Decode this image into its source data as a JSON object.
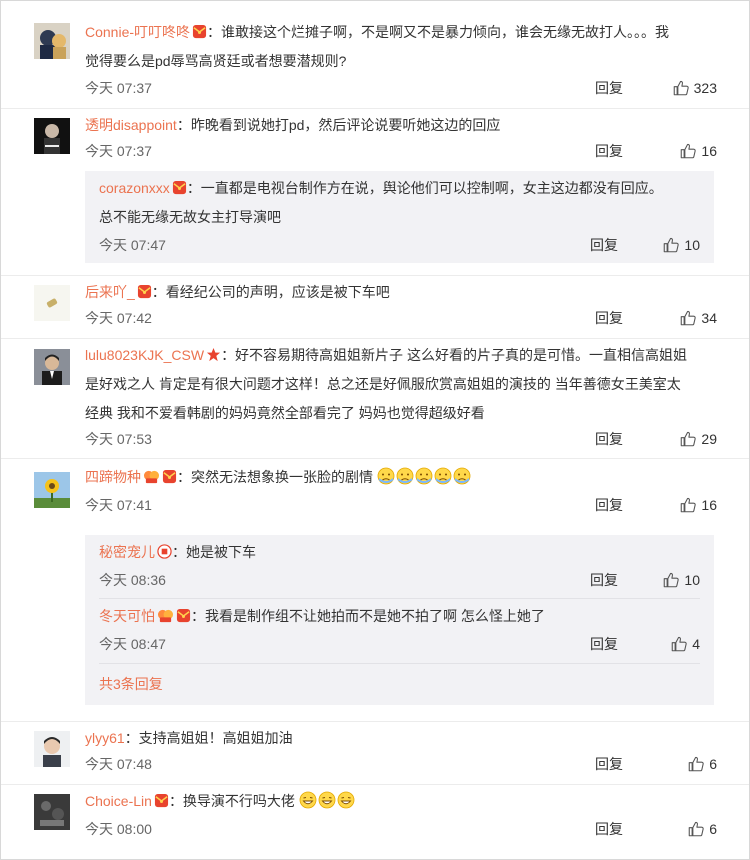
{
  "colors": {
    "name": "#eb7350",
    "text": "#333333",
    "meta": "#666666",
    "subbox_bg": "#f2f2f5"
  },
  "icons": {
    "badge": "red-envelope-badge-icon",
    "star": "red-star-badge-icon",
    "like": "thumb-up-icon",
    "fortune": "fortune-badge-icon",
    "fan": "fan-badge-icon",
    "emoji_sad": "sad-face-emoji",
    "emoji_grin": "grinning-face-emoji"
  },
  "comments": [
    {
      "name": "Connie-叮叮咚咚",
      "text1": "：谁敢接这个烂摊子啊，不是啊又不是暴力倾向，谁会无缘无故打人。。。我",
      "text2": "觉得要么是pd辱骂高贤廷或者想要潜规则?",
      "time": "今天 07:37",
      "reply": "回复",
      "likes": "323"
    },
    {
      "name": "透明disappoint",
      "text1": "：昨晚看到说她打pd，然后评论说要听她这边的回应",
      "time": "今天 07:37",
      "reply": "回复",
      "likes": "16",
      "subs": [
        {
          "name": "corazonxxx",
          "text1": "：一直都是电视台制作方在说，舆论他们可以控制啊，女主这边都没有回应。",
          "text2": "总不能无缘无故女主打导演吧",
          "time": "今天 07:47",
          "reply": "回复",
          "likes": "10"
        }
      ]
    },
    {
      "name": "后来吖_",
      "text1": "：看经纪公司的声明，应该是被下车吧",
      "time": "今天 07:42",
      "reply": "回复",
      "likes": "34"
    },
    {
      "name": "lulu8023KJK_CSW",
      "text1": "：好不容易期待高姐姐新片子 这么好看的片子真的是可惜。一直相信高姐姐",
      "text2": "是好戏之人 肯定是有很大问题才这样！总之还是好佩服欣赏高姐姐的演技的 当年善德女王美室太",
      "text3": "经典 我和不爱看韩剧的妈妈竟然全部看完了  妈妈也觉得超级好看",
      "time": "今天 07:53",
      "reply": "回复",
      "likes": "29"
    },
    {
      "name": "四蹄物种",
      "text1": "：突然无法想象换一张脸的剧情",
      "time": "今天 07:41",
      "reply": "回复",
      "likes": "16",
      "subs": [
        {
          "name": "秘密宠儿",
          "text1": "：她是被下车",
          "time": "今天 08:36",
          "reply": "回复",
          "likes": "10"
        },
        {
          "name": "冬天可怕",
          "text1": "：我看是制作组不让她拍而不是她不拍了啊 怎么怪上她了",
          "time": "今天 08:47",
          "reply": "回复",
          "likes": "4"
        }
      ],
      "more": "共3条回复"
    },
    {
      "name": "ylyy61",
      "text1": "：支持高姐姐！高姐姐加油",
      "time": "今天 07:48",
      "reply": "回复",
      "likes": "6"
    },
    {
      "name": "Choice-Lin",
      "text1": "：换导演不行吗大佬",
      "time": "今天 08:00",
      "reply": "回复",
      "likes": "6"
    }
  ]
}
